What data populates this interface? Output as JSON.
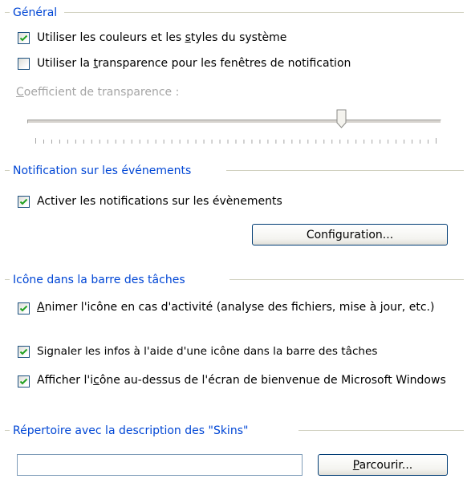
{
  "general": {
    "title": "Général",
    "use_system_colors": {
      "pre": "Utiliser les couleurs et les ",
      "accel": "s",
      "post": "tyles du système",
      "checked": true
    },
    "use_transparency": {
      "pre": "Utiliser la ",
      "accel": "t",
      "post": "ransparence pour les fenêtres de notification",
      "checked": false
    },
    "transparency_coefficient": {
      "accel": "C",
      "post": "oefficient de transparence :"
    },
    "slider_position_fraction": 0.77
  },
  "event_notification": {
    "title": "Notification sur les événements",
    "enable_notifications": {
      "label": "Activer les notifications sur les évènements",
      "checked": true
    },
    "configuration_button": "Configuration..."
  },
  "tray_icon": {
    "title": "Icône dans la barre des tâches",
    "animate_icon": {
      "accel": "A",
      "post": "nimer l'icône en cas d'activité (analyse des fichiers, mise à jour, etc.)",
      "checked": true
    },
    "signal_info": {
      "label": "Signaler les infos à l'aide d'une icône dans la barre des tâches",
      "checked": true
    },
    "show_above_welcome": {
      "pre": "Afficher l'i",
      "accel": "c",
      "post": "ône au-dessus de l'écran de bienvenue de Microsoft Windows",
      "checked": true
    }
  },
  "skins": {
    "title": "Répertoire avec la description des \"Skins\"",
    "path_value": "",
    "browse_button": {
      "accel": "P",
      "post": "arcourir..."
    }
  },
  "colors": {
    "group_title": "#0046d5",
    "divider": "#d0d0bf",
    "check_mark": "#21a121",
    "disabled_text": "#a5a5a5",
    "button_border": "#003c74"
  }
}
